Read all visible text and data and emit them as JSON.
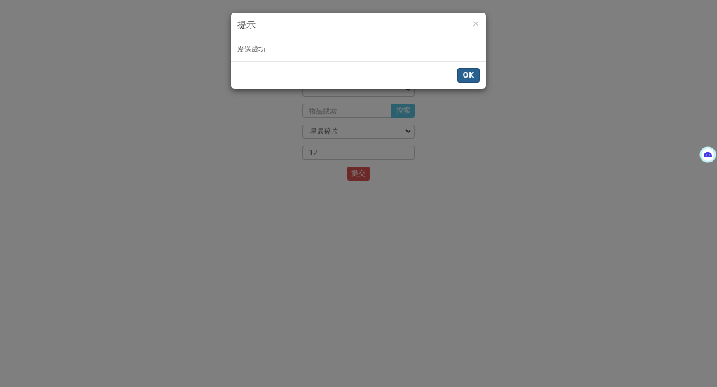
{
  "form": {
    "search": {
      "placeholder": "物品搜索",
      "button": "搜索"
    },
    "item": {
      "value": "星辰碎片"
    },
    "quantity": {
      "value": "12"
    },
    "submit": "提交"
  },
  "dialog": {
    "title": "提示",
    "close": "×",
    "message": "发送成功",
    "ok": "OK"
  }
}
